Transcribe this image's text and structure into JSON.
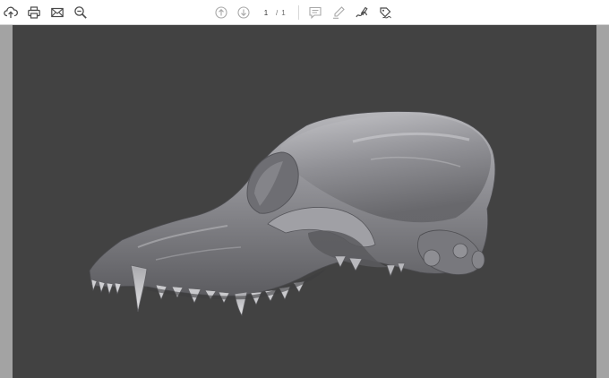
{
  "toolbar": {
    "page_current": "1",
    "page_separator": "/",
    "page_total": "1",
    "icons": [
      "upload-icon",
      "print-icon",
      "email-icon",
      "zoom-out-icon",
      "page-up-icon",
      "page-down-icon",
      "comment-icon",
      "highlight-icon",
      "draw-icon",
      "sign-icon"
    ]
  },
  "colors": {
    "toolbar_bg": "#ffffff",
    "canvas_bg": "#424242",
    "gutter_bg": "#a3a3a3",
    "icon_active": "#4a4a4a",
    "icon_disabled": "#a8a8a8"
  },
  "content": {
    "subject": "dog-skull-3d-model"
  }
}
